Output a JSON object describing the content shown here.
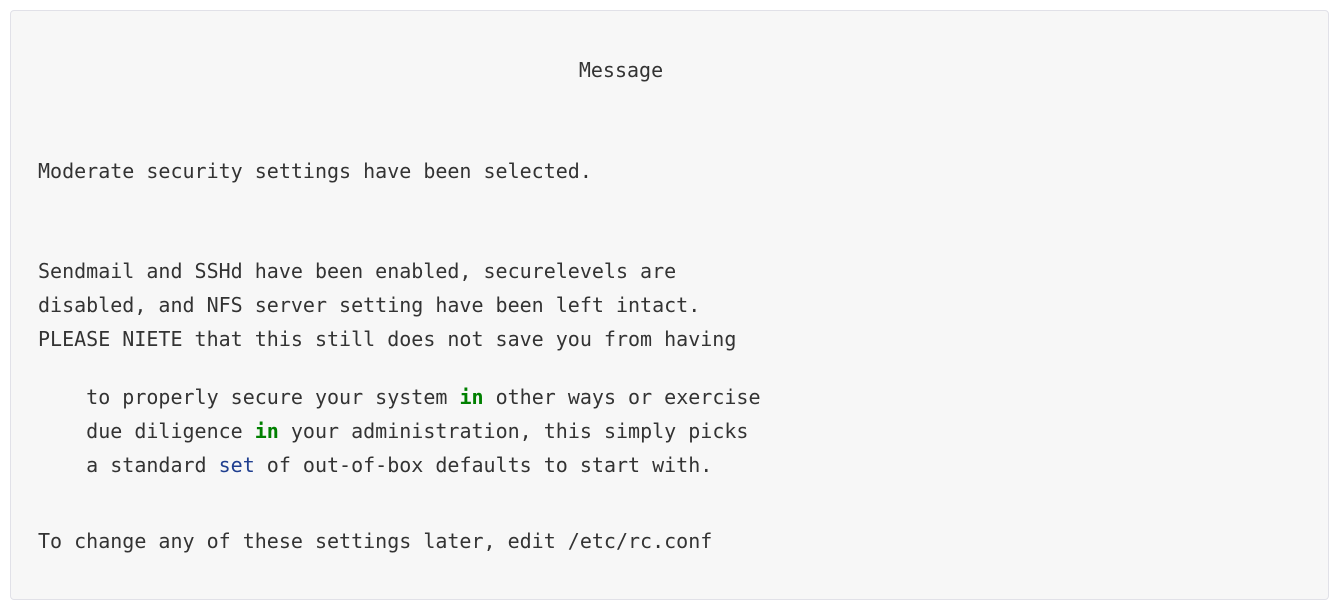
{
  "dialog": {
    "title": "Message",
    "lines": {
      "l1": "Moderate security settings have been selected.",
      "l2": "Sendmail and SSHd have been enabled, securelevels are",
      "l3": "disabled, and NFS server setting have been left intact.",
      "l4": "PLEASE NIETE that this still does not save you from having",
      "l5a": "to properly secure your system ",
      "l5kw": "in",
      "l5b": " other ways or exercise",
      "l6a": "due diligence ",
      "l6kw": "in",
      "l6b": " your administration, this simply picks",
      "l7a": "a standard ",
      "l7kw": "set",
      "l7b": " of out-of-box defaults to start with.",
      "l8": "To change any of these settings later, edit /etc/rc.conf"
    },
    "colors": {
      "background": "#f7f7f7",
      "text": "#333333",
      "keyword_green": "#008000",
      "keyword_blue": "#1f3e8f",
      "border": "#e1e1e8"
    }
  }
}
